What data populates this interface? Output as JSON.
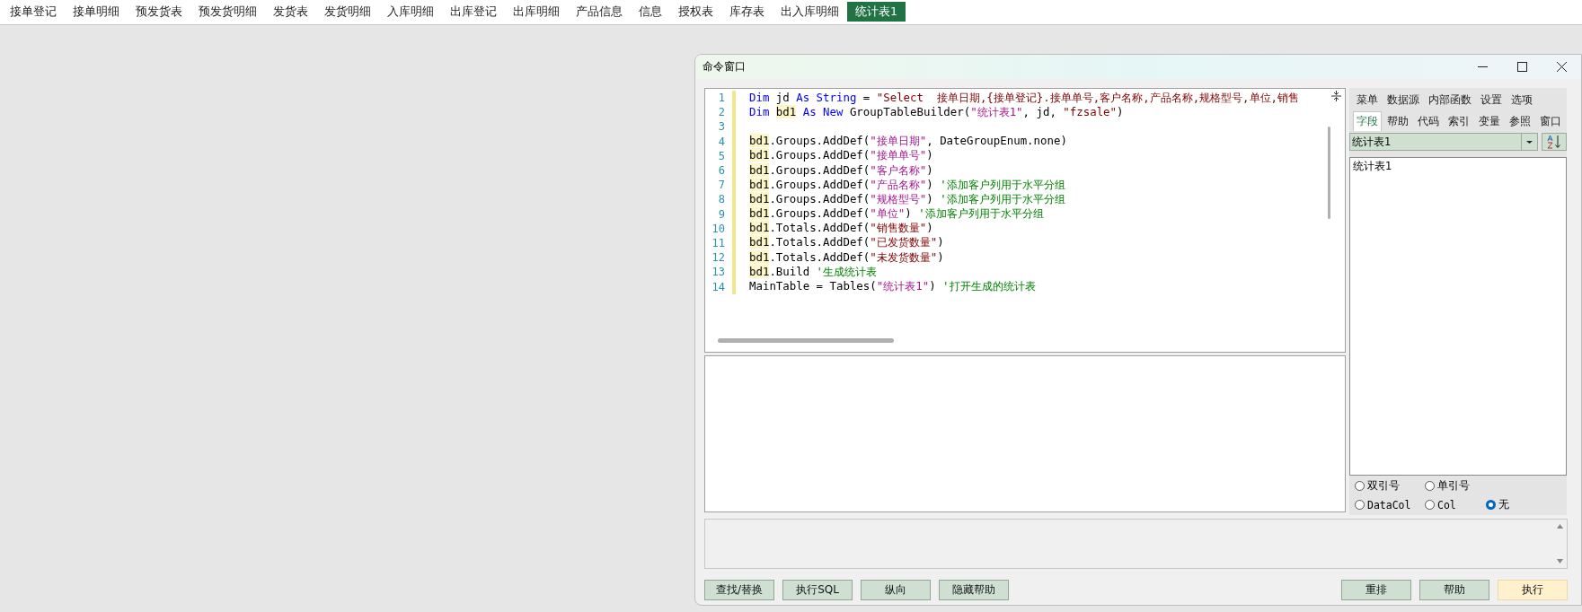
{
  "tabs": [
    {
      "label": "接单登记",
      "selected": false
    },
    {
      "label": "接单明细",
      "selected": false
    },
    {
      "label": "预发货表",
      "selected": false
    },
    {
      "label": "预发货明细",
      "selected": false
    },
    {
      "label": "发货表",
      "selected": false
    },
    {
      "label": "发货明细",
      "selected": false
    },
    {
      "label": "入库明细",
      "selected": false
    },
    {
      "label": "出库登记",
      "selected": false
    },
    {
      "label": "出库明细",
      "selected": false
    },
    {
      "label": "产品信息",
      "selected": false
    },
    {
      "label": "信息",
      "selected": false
    },
    {
      "label": "授权表",
      "selected": false
    },
    {
      "label": "库存表",
      "selected": false
    },
    {
      "label": "出入库明细",
      "selected": false
    },
    {
      "label": "统计表1",
      "selected": true
    }
  ],
  "window": {
    "title": "命令窗口"
  },
  "editor": {
    "lines": [
      {
        "number": "1",
        "tokens": [
          {
            "kind": "keyword",
            "text": "Dim"
          },
          {
            "kind": "plain",
            "text": " jd "
          },
          {
            "kind": "keyword",
            "text": "As String"
          },
          {
            "kind": "plain",
            "text": " = "
          },
          {
            "kind": "string_dark",
            "text": "\"Select  接单日期,{接单登记}.接单单号,客户名称,产品名称,规格型号,单位,销售"
          }
        ]
      },
      {
        "number": "2",
        "tokens": [
          {
            "kind": "keyword",
            "text": "Dim "
          },
          {
            "kind": "highlight",
            "text": "bd1"
          },
          {
            "kind": "keyword",
            "text": " As New"
          },
          {
            "kind": "plain",
            "text": " GroupTableBuilder("
          },
          {
            "kind": "string",
            "text": "\"统计表1\""
          },
          {
            "kind": "plain",
            "text": ", jd, "
          },
          {
            "kind": "string_dark",
            "text": "\"fzsale\""
          },
          {
            "kind": "plain",
            "text": ")"
          }
        ]
      },
      {
        "number": "3"
      },
      {
        "number": "4",
        "tokens": [
          {
            "kind": "highlight",
            "text": "bd1"
          },
          {
            "kind": "plain",
            "text": ".Groups.AddDef("
          },
          {
            "kind": "string",
            "text": "\"接单日期\""
          },
          {
            "kind": "plain",
            "text": ", DateGroupEnum.none)"
          }
        ]
      },
      {
        "number": "5",
        "tokens": [
          {
            "kind": "highlight",
            "text": "bd1"
          },
          {
            "kind": "plain",
            "text": ".Groups.AddDef("
          },
          {
            "kind": "string",
            "text": "\"接单单号\""
          },
          {
            "kind": "plain",
            "text": ")"
          }
        ]
      },
      {
        "number": "6",
        "tokens": [
          {
            "kind": "highlight",
            "text": "bd1"
          },
          {
            "kind": "plain",
            "text": ".Groups.AddDef("
          },
          {
            "kind": "string",
            "text": "\"客户名称\""
          },
          {
            "kind": "plain",
            "text": ")"
          }
        ]
      },
      {
        "number": "7",
        "tokens": [
          {
            "kind": "highlight",
            "text": "bd1"
          },
          {
            "kind": "plain",
            "text": ".Groups.AddDef("
          },
          {
            "kind": "string",
            "text": "\"产品名称\""
          },
          {
            "kind": "plain",
            "text": ") "
          },
          {
            "kind": "comment",
            "text": "'添加客户列用于水平分组"
          }
        ]
      },
      {
        "number": "8",
        "tokens": [
          {
            "kind": "highlight",
            "text": "bd1"
          },
          {
            "kind": "plain",
            "text": ".Groups.AddDef("
          },
          {
            "kind": "string",
            "text": "\"规格型号\""
          },
          {
            "kind": "plain",
            "text": ") "
          },
          {
            "kind": "comment",
            "text": "'添加客户列用于水平分组"
          }
        ]
      },
      {
        "number": "9",
        "tokens": [
          {
            "kind": "highlight",
            "text": "bd1"
          },
          {
            "kind": "plain",
            "text": ".Groups.AddDef("
          },
          {
            "kind": "string",
            "text": "\"单位\""
          },
          {
            "kind": "plain",
            "text": ") "
          },
          {
            "kind": "comment",
            "text": "'添加客户列用于水平分组"
          }
        ]
      },
      {
        "number": "10",
        "tokens": [
          {
            "kind": "highlight",
            "text": "bd1"
          },
          {
            "kind": "plain",
            "text": ".Totals.AddDef("
          },
          {
            "kind": "string_dark",
            "text": "\"销售数量\""
          },
          {
            "kind": "plain",
            "text": ")"
          }
        ]
      },
      {
        "number": "11",
        "tokens": [
          {
            "kind": "highlight",
            "text": "bd1"
          },
          {
            "kind": "plain",
            "text": ".Totals.AddDef("
          },
          {
            "kind": "string_dark",
            "text": "\"已发货数量\""
          },
          {
            "kind": "plain",
            "text": ")"
          }
        ]
      },
      {
        "number": "12",
        "tokens": [
          {
            "kind": "highlight",
            "text": "bd1"
          },
          {
            "kind": "plain",
            "text": ".Totals.AddDef("
          },
          {
            "kind": "string_dark",
            "text": "\"未发货数量\""
          },
          {
            "kind": "plain",
            "text": ")"
          }
        ]
      },
      {
        "number": "13",
        "tokens": [
          {
            "kind": "highlight",
            "text": "bd1"
          },
          {
            "kind": "plain",
            "text": ".Build "
          },
          {
            "kind": "comment",
            "text": "'生成统计表"
          }
        ]
      },
      {
        "number": "14",
        "tokens": [
          {
            "kind": "plain",
            "text": "MainTable = Tables("
          },
          {
            "kind": "string",
            "text": "\"统计表1\""
          },
          {
            "kind": "plain",
            "text": ") "
          },
          {
            "kind": "comment",
            "text": "'打开生成的统计表"
          }
        ]
      }
    ]
  },
  "help_panel": {
    "menu_tabs": [
      {
        "label": "菜单",
        "selected": false
      },
      {
        "label": "数据源",
        "selected": false
      },
      {
        "label": "内部函数",
        "selected": false
      },
      {
        "label": "设置",
        "selected": false
      },
      {
        "label": "选项",
        "selected": false
      }
    ],
    "section_tabs": [
      {
        "label": "字段",
        "selected": true
      },
      {
        "label": "帮助",
        "selected": false
      },
      {
        "label": "代码",
        "selected": false
      },
      {
        "label": "索引",
        "selected": false
      },
      {
        "label": "变量",
        "selected": false
      },
      {
        "label": "参照",
        "selected": false
      },
      {
        "label": "窗口",
        "selected": false
      }
    ],
    "table_select": {
      "value": "统计表1"
    },
    "items": [
      "统计表1"
    ],
    "quote_options": [
      {
        "label": "双引号",
        "selected": false
      },
      {
        "label": "单引号",
        "selected": false
      },
      {
        "label": "DataCol",
        "selected": false
      },
      {
        "label": "Col",
        "selected": false
      },
      {
        "label": "无",
        "selected": true
      }
    ]
  },
  "buttons_left": [
    {
      "label": "查找/替换",
      "kind": "normal"
    },
    {
      "label": "执行SQL",
      "kind": "normal"
    },
    {
      "label": "纵向",
      "kind": "normal"
    },
    {
      "label": "隐藏帮助",
      "kind": "normal"
    }
  ],
  "buttons_right": [
    {
      "label": "重排",
      "kind": "normal"
    },
    {
      "label": "帮助",
      "kind": "normal"
    },
    {
      "label": "执行",
      "kind": "primary"
    }
  ]
}
